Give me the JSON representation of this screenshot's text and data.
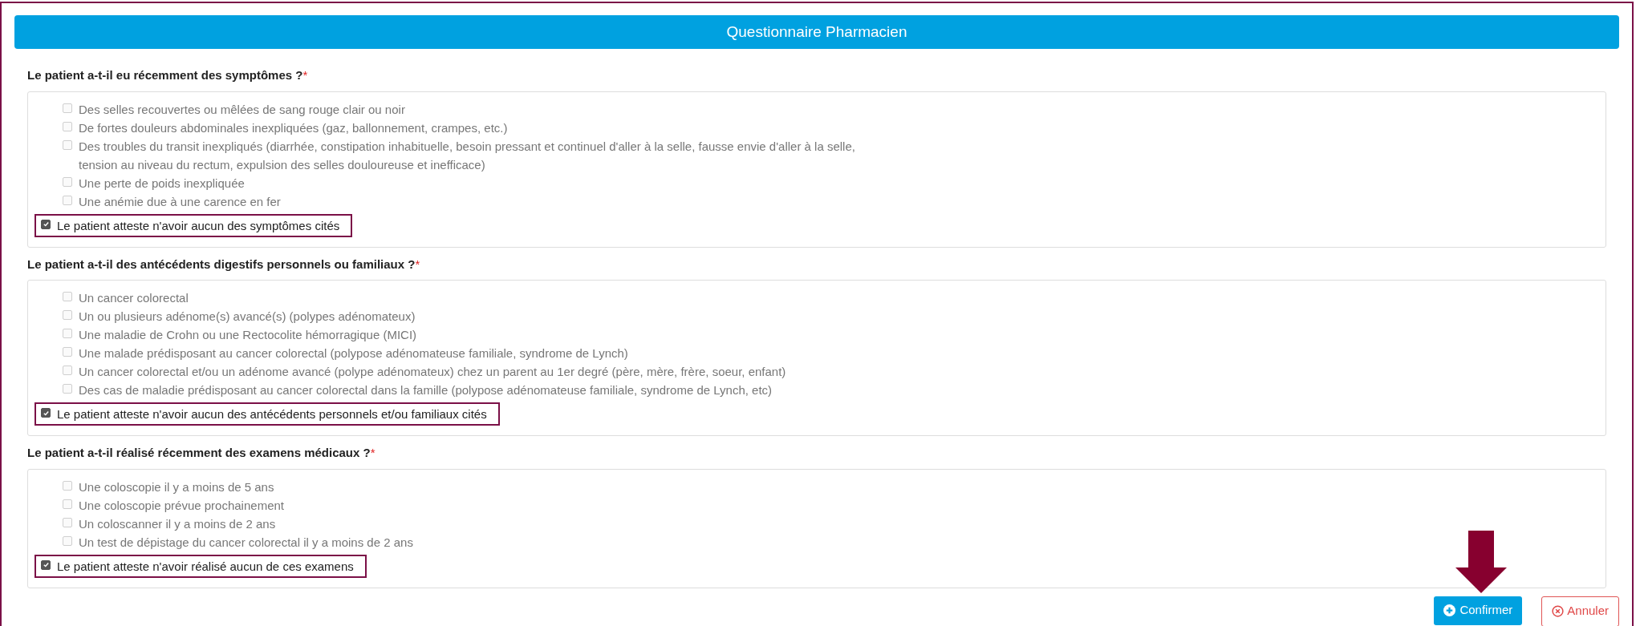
{
  "header": {
    "title": "Questionnaire Pharmacien"
  },
  "questions": [
    {
      "title": "Le patient a-t-il eu récemment des symptômes ?",
      "required_mark": "*",
      "options": [
        {
          "label": "Des selles recouvertes ou mêlées de sang rouge clair ou noir",
          "kind": "option",
          "checked": false
        },
        {
          "label": "De fortes douleurs abdominales inexpliquées (gaz, ballonnement, crampes, etc.)",
          "kind": "option",
          "checked": false
        },
        {
          "label": "Des troubles du transit inexpliqués (diarrhée, constipation inhabituelle, besoin pressant et continuel d'aller à la selle, fausse envie d'aller à la selle, tension au niveau du rectum, expulsion des selles douloureuse et inefficace)",
          "kind": "option",
          "checked": false
        },
        {
          "label": "Une perte de poids inexpliquée",
          "kind": "option",
          "checked": false
        },
        {
          "label": "Une anémie due à une carence en fer",
          "kind": "option",
          "checked": false
        },
        {
          "label": "Le patient atteste n'avoir aucun des symptômes cités",
          "kind": "attestation",
          "checked": true
        }
      ]
    },
    {
      "title": "Le patient a-t-il des antécédents digestifs personnels ou familiaux ?",
      "required_mark": "*",
      "options": [
        {
          "label": "Un cancer colorectal",
          "kind": "option",
          "checked": false
        },
        {
          "label": "Un ou plusieurs adénome(s) avancé(s) (polypes adénomateux)",
          "kind": "option",
          "checked": false
        },
        {
          "label": "Une maladie de Crohn ou une Rectocolite hémorragique (MICI)",
          "kind": "option",
          "checked": false
        },
        {
          "label": "Une malade prédisposant au cancer colorectal (polypose adénomateuse familiale, syndrome de Lynch)",
          "kind": "option",
          "checked": false
        },
        {
          "label": "Un cancer colorectal et/ou un adénome avancé (polype adénomateux) chez un parent au 1er degré (père, mère, frère, soeur, enfant)",
          "kind": "option",
          "checked": false
        },
        {
          "label": "Des cas de maladie prédisposant au cancer colorectal dans la famille (polypose adénomateuse familiale, syndrome de Lynch, etc)",
          "kind": "option",
          "checked": false
        },
        {
          "label": "Le patient atteste n'avoir aucun des antécédents personnels et/ou familiaux cités",
          "kind": "attestation",
          "checked": true
        }
      ]
    },
    {
      "title": "Le patient a-t-il réalisé récemment des examens médicaux ?",
      "required_mark": "*",
      "options": [
        {
          "label": "Une coloscopie il y a moins de 5 ans",
          "kind": "option",
          "checked": false
        },
        {
          "label": "Une coloscopie prévue prochainement",
          "kind": "option",
          "checked": false
        },
        {
          "label": "Un coloscanner il y a moins de 2 ans",
          "kind": "option",
          "checked": false
        },
        {
          "label": "Un test de dépistage du cancer colorectal il y a moins de 2 ans",
          "kind": "option",
          "checked": false
        },
        {
          "label": "Le patient atteste n'avoir réalisé aucun de ces examens",
          "kind": "attestation",
          "checked": true
        }
      ]
    }
  ],
  "actions": [
    {
      "label": "Confirmer",
      "kind": "primary"
    },
    {
      "label": "Annuler",
      "kind": "cancel"
    }
  ]
}
